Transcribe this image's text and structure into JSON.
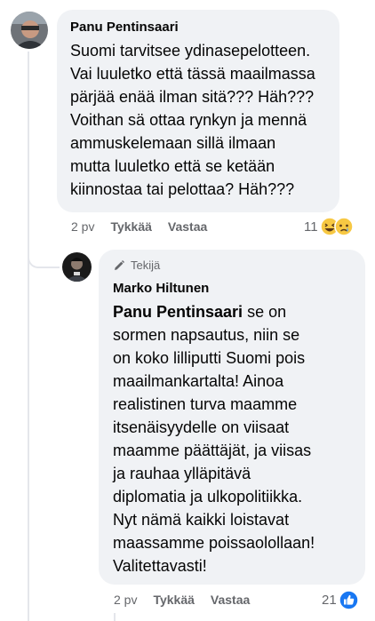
{
  "comment1": {
    "author": "Panu Pentinsaari",
    "text": "Suomi tarvitsee ydinasepelotteen.\nVai luuletko että tässä maailmassa\npärjää enää ilman sitä??? Häh???\nVoithan sä ottaa rynkyn ja mennä\nammuskelemaan sillä ilmaan\nmutta luuletko että se ketään\nkiinnostaa tai pelottaa? Häh???",
    "time": "2 pv",
    "like_label": "Tykkää",
    "reply_label": "Vastaa",
    "reaction_count": "11",
    "reaction_icons": [
      "laughing-emoji-icon",
      "sad-emoji-icon"
    ]
  },
  "comment2": {
    "badge": "Tekijä",
    "author": "Marko Hiltunen",
    "mention": "Panu Pentinsaari",
    "text": " se on\nsormen napsautus, niin se\non koko lilliputti Suomi pois\nmaailmankartalta! Ainoa\nrealistinen turva maamme\nitsenäisyydelle on viisaat\nmaamme päättäjät, ja viisas\nja rauhaa ylläpitävä\ndiplomatia ja ulkopolitiikka.\nNyt nämä kaikki loistavat\nmaassamme poissaolollaan!\nValitettavasti!",
    "time": "2 pv",
    "like_label": "Tykkää",
    "reply_label": "Vastaa",
    "reaction_count": "21",
    "reaction_icons": [
      "thumbs-up-icon"
    ]
  },
  "colors": {
    "bubble": "#f0f2f5",
    "meta": "#65676b",
    "like_blue": "#1877f2"
  }
}
